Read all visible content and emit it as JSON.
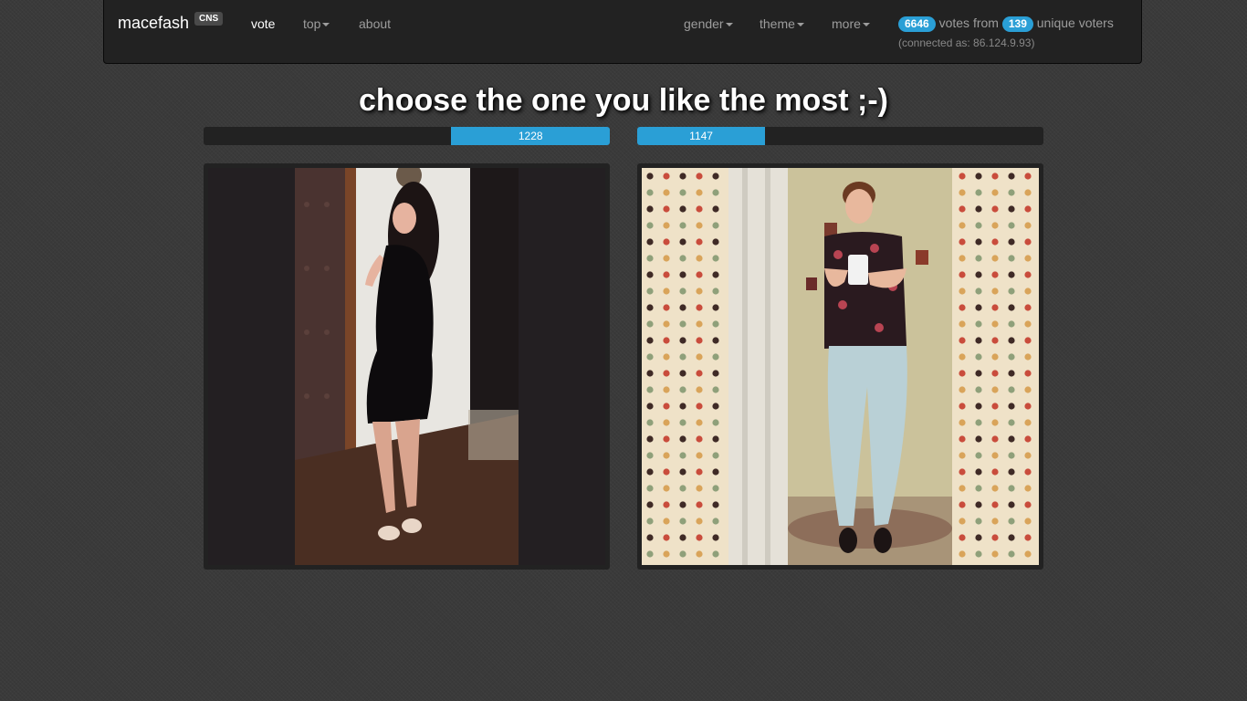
{
  "navbar": {
    "brand": "macefash",
    "badge": "CNS",
    "links": {
      "vote": "vote",
      "top": "top",
      "about": "about",
      "gender": "gender",
      "theme": "theme",
      "more": "more"
    },
    "stats": {
      "votes": "6646",
      "votes_from": "votes from",
      "voters": "139",
      "unique_voters": "unique voters",
      "connected": "(connected as: 86.124.9.93)"
    }
  },
  "headline": "choose the one you like the most ;-)",
  "contestants": [
    {
      "votes_label": "1228",
      "vote_fraction": 0.39
    },
    {
      "votes_label": "1147",
      "vote_fraction": 0.315
    }
  ],
  "colors": {
    "accent": "#2a9fd6",
    "navbar": "#222222",
    "background": "#3a3a3a"
  }
}
